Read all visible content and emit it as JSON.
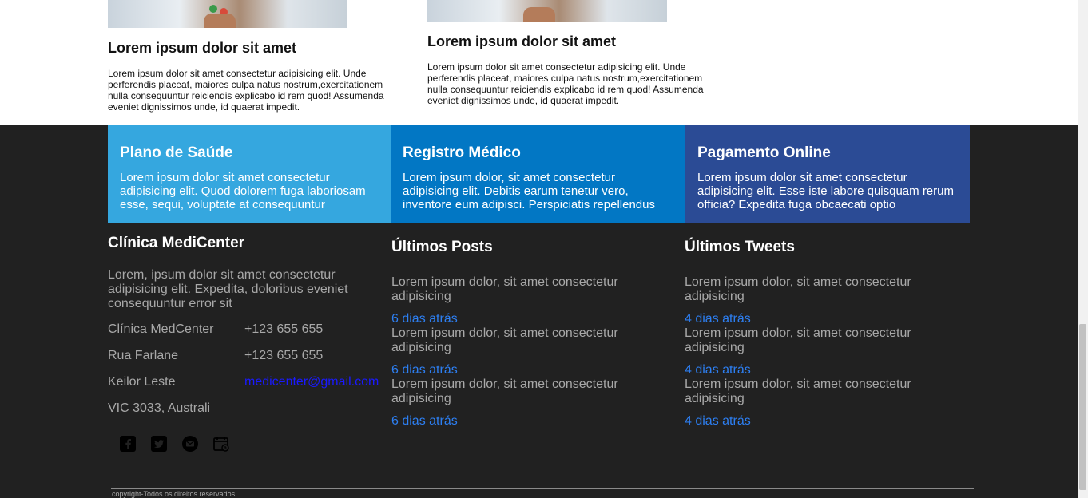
{
  "articles": [
    {
      "title": "Lorem ipsum dolor sit amet",
      "body": "Lorem ipsum dolor sit amet consectetur adipisicing elit. Unde perferendis placeat, maiores culpa natus nostrum,exercitationem nulla consequuntur reiciendis explicabo id rem quod! Assumenda eveniet dignissimos unde, id quaerat impedit."
    },
    {
      "title": "Lorem ipsum dolor sit amet",
      "body": "Lorem ipsum dolor sit amet consectetur adipisicing elit. Unde perferendis placeat, maiores culpa natus nostrum,exercitationem nulla consequuntur reiciendis explicabo id rem quod! Assumenda eveniet dignissimos unde, id quaerat impedit."
    }
  ],
  "features": [
    {
      "title": "Plano de Saúde",
      "body": "Lorem ipsum dolor sit amet consectetur adipisicing elit. Quod dolorem fuga laboriosam esse, sequi, voluptate at consequuntur",
      "color": "#35a7df"
    },
    {
      "title": "Registro Médico",
      "body": "Lorem ipsum dolor, sit amet consectetur adipisicing elit. Debitis earum tenetur vero, inventore eum adipisci. Perspiciatis repellendus",
      "color": "#0277c4"
    },
    {
      "title": "Pagamento Online",
      "body": "Lorem ipsum dolor sit amet consectetur adipisicing elit. Esse iste labore quisquam rerum officia? Expedita fuga obcaecati optio",
      "color": "#2b4b95"
    }
  ],
  "clinic": {
    "title": "Clínica MediCenter",
    "about": "Lorem, ipsum dolor sit amet consectetur adipisicing elit. Expedita, doloribus eveniet consequuntur error sit",
    "address": [
      "Clínica MedCenter",
      "Rua Farlane",
      "Keilor Leste",
      "VIC 3033, Australi"
    ],
    "phone1": "+123 655 655",
    "phone2": "+123 655 655",
    "email": "medicenter@gmail.com",
    "social_icons": [
      "facebook-icon",
      "twitter-icon",
      "email-icon",
      "calendar-icon"
    ]
  },
  "posts": {
    "title": "Últimos Posts",
    "items": [
      {
        "text": "Lorem ipsum dolor, sit amet consectetur adipisicing",
        "ago": "6 dias atrás"
      },
      {
        "text": "Lorem ipsum dolor, sit amet consectetur adipisicing",
        "ago": "6 dias atrás"
      },
      {
        "text": "Lorem ipsum dolor, sit amet consectetur adipisicing",
        "ago": "6 dias atrás"
      }
    ]
  },
  "tweets": {
    "title": "Últimos Tweets",
    "items": [
      {
        "text": "Lorem ipsum dolor, sit amet consectetur adipisicing",
        "ago": "4 dias atrás"
      },
      {
        "text": "Lorem ipsum dolor, sit amet consectetur adipisicing",
        "ago": "4 dias atrás"
      },
      {
        "text": "Lorem ipsum dolor, sit amet consectetur adipisicing",
        "ago": "4 dias atrás"
      }
    ]
  },
  "copyright": "copyright-Todos os direitos reservados",
  "colors": {
    "footer_bg": "#212121",
    "link": "#2d7ff2",
    "email_link": "#1a1aff"
  }
}
